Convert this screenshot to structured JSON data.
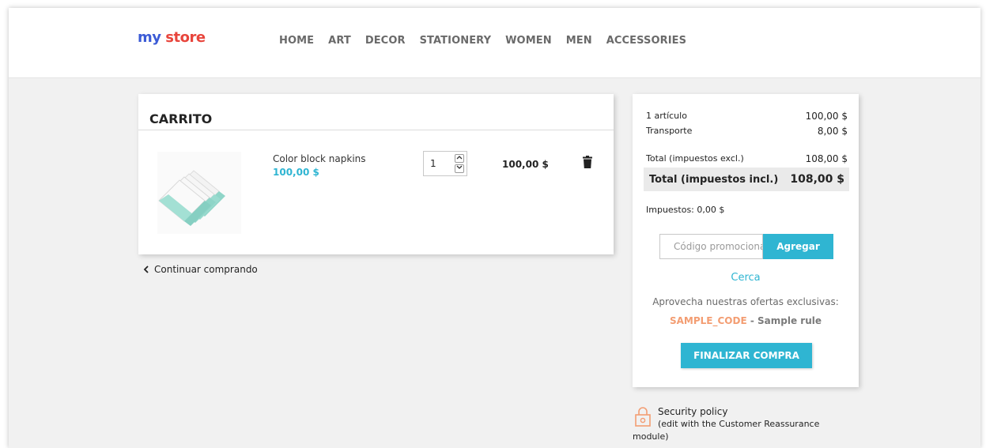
{
  "header": {
    "logo": {
      "part1": "my",
      "part2": "store"
    },
    "nav": [
      "HOME",
      "ART",
      "DECOR",
      "STATIONERY",
      "WOMEN",
      "MEN",
      "ACCESSORIES"
    ]
  },
  "cart": {
    "title": "CARRITO",
    "item": {
      "name": "Color block napkins",
      "unit_price": "100,00 $",
      "quantity": "1",
      "line_total": "100,00 $"
    },
    "continue_label": "Continuar comprando"
  },
  "summary": {
    "items_label": "1 artículo",
    "items_value": "100,00 $",
    "shipping_label": "Transporte",
    "shipping_value": "8,00 $",
    "total_excl_label": "Total (impuestos excl.)",
    "total_excl_value": "108,00 $",
    "total_incl_label": "Total (impuestos incl.)",
    "total_incl_value": "108,00 $",
    "taxes": "Impuestos: 0,00 $",
    "promo_placeholder": "Código promocional",
    "promo_button": "Agregar",
    "close_link": "Cerca",
    "offers_text": "Aprovecha nuestras ofertas exclusivas:",
    "offer_code": "SAMPLE_CODE",
    "offer_rule": "- Sample rule",
    "checkout_button": "FINALIZAR COMPRA"
  },
  "reassurance": {
    "title": "Security policy",
    "subtitle_line1": "(edit with the Customer Reassurance",
    "subtitle_line2": "module)"
  },
  "colors": {
    "accent": "#2fb5d2",
    "offer_code": "#f39d72",
    "background": "#f1f1f1"
  },
  "icons": [
    "chevron-left-icon",
    "trash-icon",
    "lock-icon",
    "chevron-up-icon",
    "chevron-down-icon"
  ]
}
